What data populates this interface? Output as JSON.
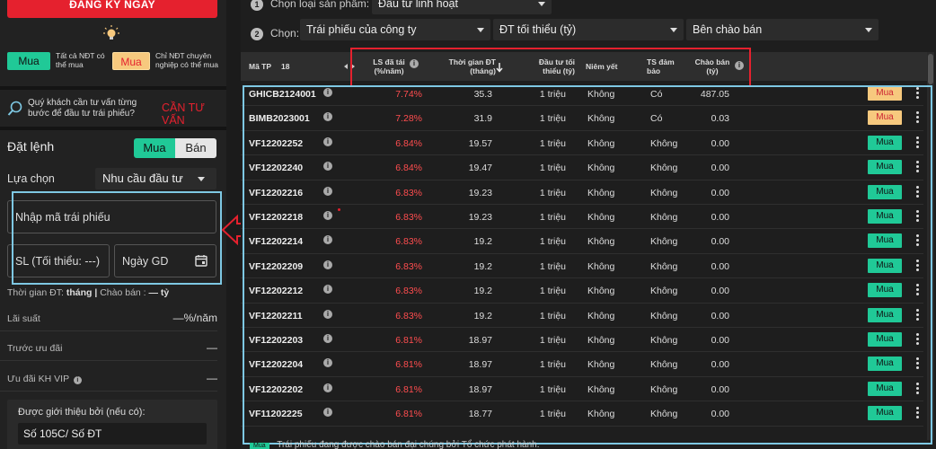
{
  "left": {
    "register_label": "ĐĂNG KÝ NGAY",
    "mua_all_label": "Mua",
    "mua_all_text": "Tất cả NĐT có thể mua",
    "mua_pro_label": "Mua",
    "mua_pro_text": "Chỉ NĐT chuyên nghiệp có thể mua",
    "advice_text": "Quý khách cần tư vấn từng bước để đầu tư trái phiếu?",
    "advice_link": "CẦN TƯ VẤN",
    "order_title": "Đặt lệnh",
    "buy_tab": "Mua",
    "sell_tab": "Bán",
    "choice_label": "Lựa chọn",
    "choice_value": "Nhu cầu đầu tư",
    "bond_code_placeholder": "Nhập mã trái phiếu",
    "qty_placeholder": "SL (Tối thiểu: ---)",
    "date_placeholder": "Ngày GD",
    "term_label": "Thời gian ĐT:",
    "term_unit": "tháng",
    "sep": "|",
    "offer_label": "Chào bán :",
    "offer_value": "— tỷ",
    "rate_label": "Lãi suất",
    "rate_value": "—%/năm",
    "pre_promo_label": "Trước ưu đãi",
    "pre_promo_value": "—",
    "vip_label": "Ưu đãi KH VIP",
    "vip_value": "—",
    "referral_label": "Được giới thiệu bởi (nếu có):",
    "referral_value": "Số 105C/ Số ĐT"
  },
  "filters": {
    "step1_num": "1",
    "step1_label": "Chọn loại sản phẩm:",
    "step1_value": "Đầu tư linh hoạt",
    "step2_num": "2",
    "step2_label": "Chọn:",
    "bond_type": "Trái phiếu của công ty",
    "min_invest": "ĐT tối thiểu (tỷ)",
    "seller": "Bên chào bán"
  },
  "table": {
    "headers": {
      "code": "Mã TP",
      "count": "18",
      "rate": "LS đã tái (%/năm)",
      "term": "Thời gian ĐT (tháng)",
      "min": "Đầu tư tối thiểu (tỷ)",
      "listed": "Niêm yết",
      "collateral": "TS đảm bảo",
      "offer": "Chào bán (tỷ)"
    },
    "rows": [
      {
        "code": "GHICB2124001",
        "rate": "7.74%",
        "term": "35.3",
        "min": "1 triệu",
        "listed": "Không",
        "collateral": "Có",
        "offer": "487.05",
        "action": "Mua",
        "pro": true
      },
      {
        "code": "BIMB2023001",
        "rate": "7.28%",
        "term": "31.9",
        "min": "1 triệu",
        "listed": "Không",
        "collateral": "Có",
        "offer": "0.03",
        "action": "Mua",
        "pro": true
      },
      {
        "code": "VF12202252",
        "rate": "6.84%",
        "term": "19.57",
        "min": "1 triệu",
        "listed": "Không",
        "collateral": "Không",
        "offer": "0.00",
        "action": "Mua",
        "pro": false
      },
      {
        "code": "VF12202240",
        "rate": "6.84%",
        "term": "19.47",
        "min": "1 triệu",
        "listed": "Không",
        "collateral": "Không",
        "offer": "0.00",
        "action": "Mua",
        "pro": false
      },
      {
        "code": "VF12202216",
        "rate": "6.83%",
        "term": "19.23",
        "min": "1 triệu",
        "listed": "Không",
        "collateral": "Không",
        "offer": "0.00",
        "action": "Mua",
        "pro": false
      },
      {
        "code": "VF12202218",
        "rate": "6.83%",
        "term": "19.23",
        "min": "1 triệu",
        "listed": "Không",
        "collateral": "Không",
        "offer": "0.00",
        "action": "Mua",
        "pro": false
      },
      {
        "code": "VF12202214",
        "rate": "6.83%",
        "term": "19.2",
        "min": "1 triệu",
        "listed": "Không",
        "collateral": "Không",
        "offer": "0.00",
        "action": "Mua",
        "pro": false
      },
      {
        "code": "VF12202209",
        "rate": "6.83%",
        "term": "19.2",
        "min": "1 triệu",
        "listed": "Không",
        "collateral": "Không",
        "offer": "0.00",
        "action": "Mua",
        "pro": false
      },
      {
        "code": "VF12202212",
        "rate": "6.83%",
        "term": "19.2",
        "min": "1 triệu",
        "listed": "Không",
        "collateral": "Không",
        "offer": "0.00",
        "action": "Mua",
        "pro": false
      },
      {
        "code": "VF12202211",
        "rate": "6.83%",
        "term": "19.2",
        "min": "1 triệu",
        "listed": "Không",
        "collateral": "Không",
        "offer": "0.00",
        "action": "Mua",
        "pro": false
      },
      {
        "code": "VF12202203",
        "rate": "6.81%",
        "term": "18.97",
        "min": "1 triệu",
        "listed": "Không",
        "collateral": "Không",
        "offer": "0.00",
        "action": "Mua",
        "pro": false
      },
      {
        "code": "VF12202204",
        "rate": "6.81%",
        "term": "18.97",
        "min": "1 triệu",
        "listed": "Không",
        "collateral": "Không",
        "offer": "0.00",
        "action": "Mua",
        "pro": false
      },
      {
        "code": "VF12202202",
        "rate": "6.81%",
        "term": "18.97",
        "min": "1 triệu",
        "listed": "Không",
        "collateral": "Không",
        "offer": "0.00",
        "action": "Mua",
        "pro": false
      },
      {
        "code": "VF11202225",
        "rate": "6.81%",
        "term": "18.77",
        "min": "1 triệu",
        "listed": "Không",
        "collateral": "Không",
        "offer": "0.00",
        "action": "Mua",
        "pro": false
      }
    ]
  },
  "footnote": {
    "tag": "Mua",
    "text": "Trái phiếu đang được chào bán đại chúng bởi Tổ chức phát hành."
  },
  "colors": {
    "accent_red": "#e5212e",
    "buy_green": "#20c997",
    "pro_orange": "#f7c97e",
    "rate_red": "#ff4d4f",
    "annotation_cyan": "#7ec8e3"
  }
}
